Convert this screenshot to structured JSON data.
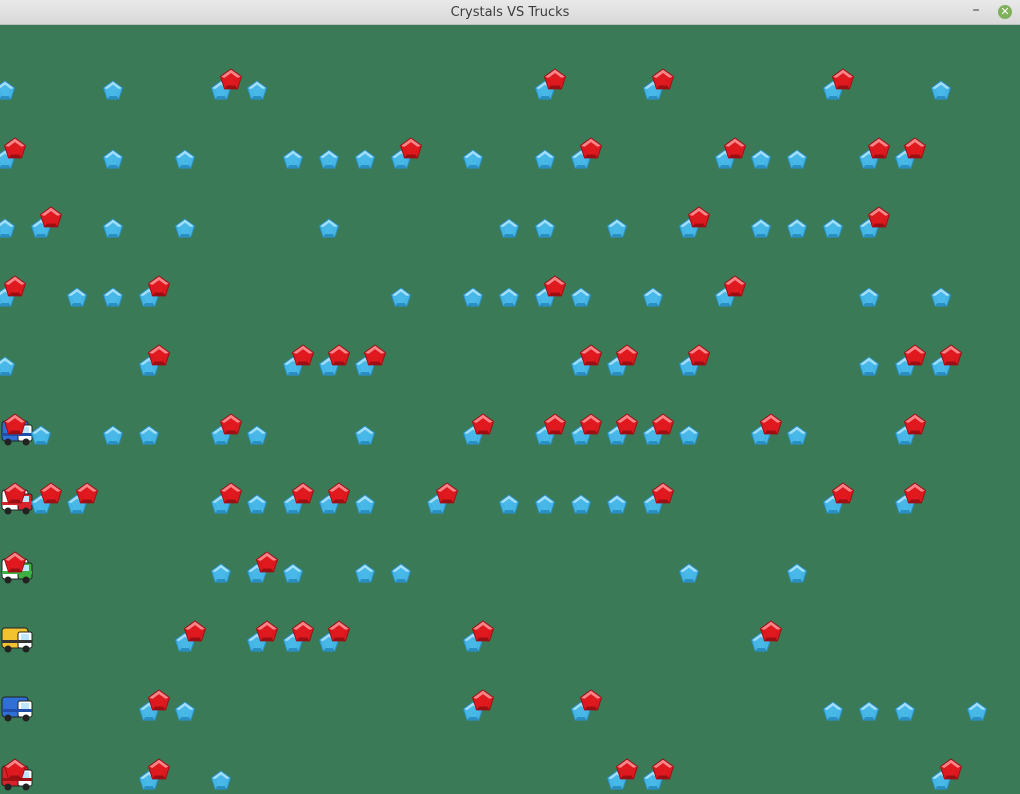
{
  "window": {
    "title": "Crystals VS Trucks",
    "minimize_glyph": "–",
    "close_glyph": "✕",
    "close_color": "#7fb05a"
  },
  "colors": {
    "background": "#3a7a56",
    "blue_crystal": "#47b8e8",
    "red_crystal": "#e0191f"
  },
  "lane_count": 11,
  "lanes": [
    {
      "blue": [
        0,
        3,
        6,
        7,
        15,
        18,
        23,
        26
      ],
      "red": [
        6,
        15,
        18,
        23
      ],
      "truck": null
    },
    {
      "blue": [
        0,
        3,
        5,
        8,
        9,
        10,
        11,
        13,
        15,
        16,
        20,
        21,
        22,
        24,
        25
      ],
      "red": [
        0,
        11,
        16,
        20,
        24,
        25
      ],
      "truck": null
    },
    {
      "blue": [
        0,
        1,
        3,
        5,
        9,
        14,
        15,
        17,
        19,
        21,
        22,
        23,
        24
      ],
      "red": [
        1,
        19,
        24
      ],
      "truck": null
    },
    {
      "blue": [
        0,
        2,
        3,
        4,
        11,
        13,
        14,
        15,
        16,
        18,
        20,
        24,
        26
      ],
      "red": [
        0,
        4,
        15,
        20
      ],
      "truck": null
    },
    {
      "blue": [
        0,
        4,
        8,
        9,
        10,
        16,
        17,
        19,
        24,
        25,
        26
      ],
      "red": [
        4,
        8,
        9,
        10,
        16,
        17,
        19,
        25,
        26
      ],
      "truck": null
    },
    {
      "blue": [
        1,
        3,
        4,
        6,
        7,
        10,
        13,
        15,
        16,
        17,
        18,
        19,
        21,
        22,
        25
      ],
      "red": [
        0,
        6,
        13,
        15,
        16,
        17,
        18,
        21,
        25
      ],
      "truck": "blue-truck"
    },
    {
      "blue": [
        1,
        2,
        6,
        7,
        8,
        9,
        10,
        12,
        14,
        15,
        16,
        17,
        18,
        23,
        25
      ],
      "red": [
        0,
        1,
        2,
        6,
        8,
        9,
        12,
        18,
        23,
        25
      ],
      "truck": "fire-truck"
    },
    {
      "blue": [
        6,
        7,
        8,
        10,
        11,
        19,
        22
      ],
      "red": [
        0,
        7
      ],
      "truck": "green-truck"
    },
    {
      "blue": [
        5,
        7,
        8,
        9,
        13,
        21
      ],
      "red": [
        5,
        7,
        8,
        9,
        13,
        21
      ],
      "truck": "yellow-truck"
    },
    {
      "blue": [
        4,
        5,
        13,
        16,
        23,
        24,
        25,
        27
      ],
      "red": [
        4,
        13,
        16
      ],
      "truck": "blue-car"
    },
    {
      "blue": [
        4,
        6,
        17,
        18,
        26
      ],
      "red": [
        0,
        4,
        17,
        18,
        26
      ],
      "truck": "red-truck"
    }
  ]
}
